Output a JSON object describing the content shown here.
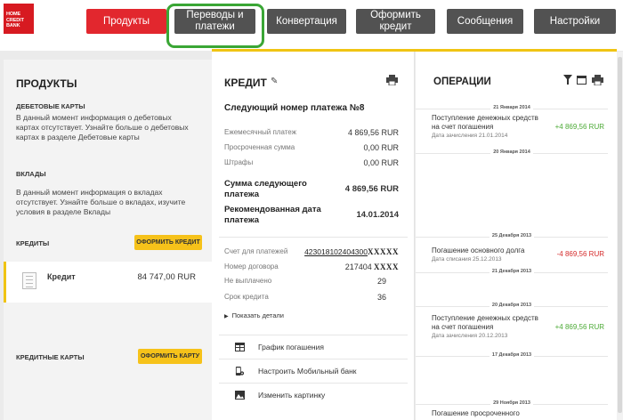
{
  "logo": {
    "line1": "HOME",
    "line2": "CREDIT",
    "line3": "BANK"
  },
  "nav": {
    "products": "Продукты",
    "transfers": "Переводы и платежи",
    "conversion": "Конвертация",
    "order_credit": "Оформить кредит",
    "messages": "Сообщения",
    "settings": "Настройки"
  },
  "left": {
    "title": "ПРОДУКТЫ",
    "debit_heading": "ДЕБЕТОВЫЕ КАРТЫ",
    "debit_text": "В данный момент информация о дебетовых картах отсутствует. Узнайте больше о дебетовых картах в разделе Дебетовые карты",
    "deposits_heading": "ВКЛАДЫ",
    "deposits_text": "В данный момент информация о вкладах отсутствует. Узнайте больше о вкладах, изучите условия в разделе Вклады",
    "credits_heading": "КРЕДИТЫ",
    "order_credit_btn": "ОФОРМИТЬ КРЕДИТ",
    "credit_item_label": "Кредит",
    "credit_item_amount": "84 747,00 RUR",
    "cards_heading": "КРЕДИТНЫЕ КАРТЫ",
    "order_card_btn": "ОФОРМИТЬ КАРТУ"
  },
  "credit": {
    "title": "КРЕДИТ",
    "next_payment": "Следующий номер платежа №8",
    "rows": [
      {
        "label": "Ежемесячный платеж",
        "value": "4 869,56 RUR"
      },
      {
        "label": "Просроченная сумма",
        "value": "0,00 RUR"
      },
      {
        "label": "Штрафы",
        "value": "0,00 RUR"
      }
    ],
    "next_sum_label": "Сумма следующего платежа",
    "next_sum_value": "4 869,56 RUR",
    "rec_date_label": "Рекомендованная дата платежа",
    "rec_date_value": "14.01.2014",
    "account_label": "Счет для платежей",
    "account_value": "423018102404300",
    "account_mask": "XXXXX",
    "contract_label": "Номер договора",
    "contract_value": "217404",
    "contract_mask": "XXXX",
    "unpaid_label": "Не выплачено",
    "unpaid_value": "29",
    "term_label": "Срок кредита",
    "term_value": "36",
    "show_details": "Показать детали",
    "menu": [
      {
        "label": "График погашения",
        "icon": "table-icon"
      },
      {
        "label": "Настроить Мобильный банк",
        "icon": "mobile-settings-icon"
      },
      {
        "label": "Изменить картинку",
        "icon": "image-icon"
      }
    ]
  },
  "ops": {
    "title": "ОПЕРАЦИИ",
    "dates": [
      "21 Января 2014",
      "20 Января 2014",
      "25 Декабря 2013",
      "21 Декабря 2013",
      "20 Декабря 2013",
      "17 Декабря 2013",
      "29 Ноября 2013"
    ],
    "items": [
      {
        "name": "Поступление денежных средств на счет погашения",
        "date": "Дата зачисления 21.01.2014",
        "sum": "+4 869,56 RUR"
      },
      {
        "name": "Погашение основного долга",
        "date": "Дата списания 25.12.2013",
        "sum": "-4 869,56 RUR"
      },
      {
        "name": "Поступление денежных средств на счет погашения",
        "date": "Дата зачисления 20.12.2013",
        "sum": "+4 869,56 RUR"
      },
      {
        "name": "Погашение просроченного",
        "date": "",
        "sum": ""
      }
    ]
  },
  "colors": {
    "accent_red": "#e2272e",
    "nav_gray": "#525252",
    "yellow": "#f0c413",
    "positive": "#4caa36",
    "negative": "#d52b2b"
  }
}
